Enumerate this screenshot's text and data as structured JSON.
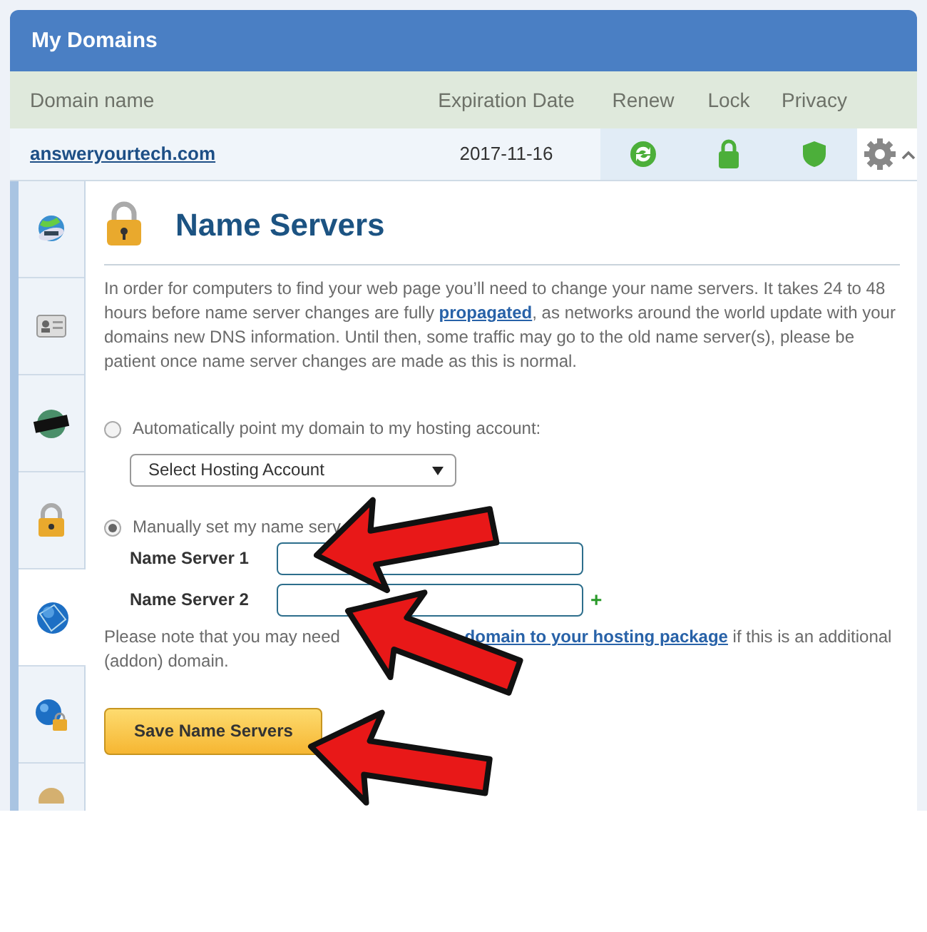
{
  "header": {
    "title": "My Domains"
  },
  "table": {
    "columns": [
      "Domain name",
      "Expiration Date",
      "Renew",
      "Lock",
      "Privacy"
    ],
    "rows": [
      {
        "domain": "answeryourtech.com",
        "expiration": "2017-11-16",
        "expanded": true
      }
    ]
  },
  "sidebar": {
    "items": [
      {
        "kind": "domain",
        "selected": false
      },
      {
        "kind": "contact",
        "selected": false
      },
      {
        "kind": "privacy",
        "selected": false
      },
      {
        "kind": "lock",
        "selected": false
      },
      {
        "kind": "dns",
        "selected": true
      },
      {
        "kind": "hosting",
        "selected": false
      },
      {
        "kind": "other",
        "selected": false
      }
    ]
  },
  "panel": {
    "title": "Name Servers",
    "intro_before": "In order for computers to find your web page you’ll need to change your name servers. It takes 24 to 48 hours before name server changes are fully",
    "intro_link": "propagated",
    "intro_after": ", as networks around the world update with your domains new DNS information. Until then, some traffic may go to the old name server(s), please be patient once name server changes are made as this is normal.",
    "options": [
      {
        "label": "Automatically point my domain to my hosting account:",
        "selected": false
      },
      {
        "label": "Manually set my name serv",
        "selected": true
      }
    ],
    "select": "Select Hosting Account",
    "fields": [
      {
        "label": "Name Server 1"
      },
      {
        "label": "Name Server 2",
        "add_button": "+"
      }
    ],
    "note_before": "Please note that you may need",
    "note_link": "domain to your hosting package",
    "note_after": "if this is an additional (addon) domain.",
    "save": "Save Name Servers"
  }
}
